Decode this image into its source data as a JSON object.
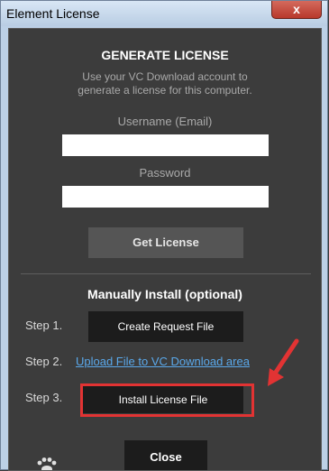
{
  "window": {
    "title": "Element License",
    "close_symbol": "x"
  },
  "generate": {
    "heading": "GENERATE LICENSE",
    "description_line1": "Use your VC Download account to",
    "description_line2": "generate a license for this computer.",
    "username_label": "Username (Email)",
    "username_value": "",
    "password_label": "Password",
    "password_value": "",
    "get_license_label": "Get License"
  },
  "manual": {
    "heading": "Manually Install (optional)",
    "step1_label": "Step 1.",
    "step1_button": "Create Request File",
    "step2_label": "Step 2.",
    "step2_link": "Upload File to VC Download area",
    "step3_label": "Step 3.",
    "step3_button": "Install License File"
  },
  "footer": {
    "close_label": "Close"
  },
  "colors": {
    "annotation_red": "#e23333",
    "link_blue": "#5aa8ea",
    "panel_bg": "#3c3c3c"
  },
  "icons": [
    "close-icon",
    "paw-logo-icon",
    "annotation-arrow-icon"
  ]
}
